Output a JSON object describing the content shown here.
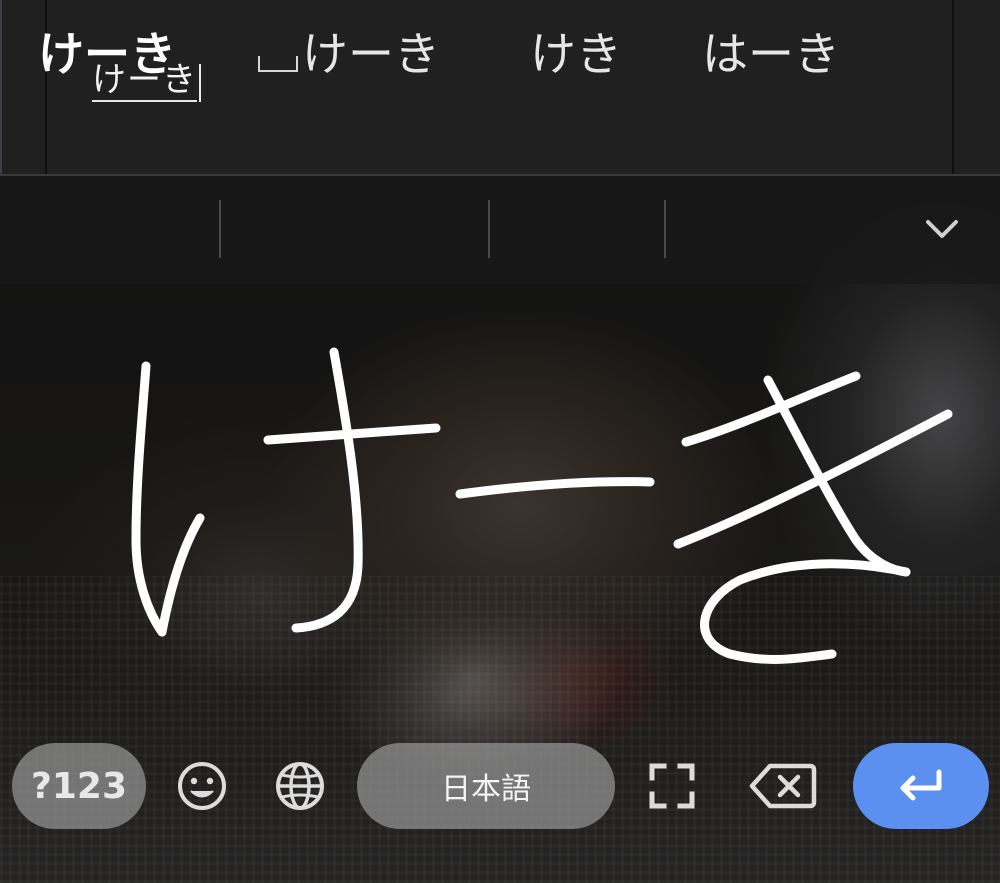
{
  "text_field": {
    "composing_text": "けーき"
  },
  "suggestions": {
    "items": [
      {
        "label": "けーき"
      },
      {
        "label": "けーき"
      },
      {
        "label": "けき"
      },
      {
        "label": "はーき"
      }
    ],
    "expand_icon": "chevron-down-icon"
  },
  "handwriting": {
    "recognized": "けーき",
    "ink_color": "#ffffff"
  },
  "bottom_row": {
    "symbols_label": "?123",
    "emoji_icon": "smiley-icon",
    "language_icon": "globe-icon",
    "space_label": "日本語",
    "fullscreen_icon": "fullscreen-icon",
    "delete_icon": "backspace-icon",
    "enter_icon": "enter-arrow-icon"
  },
  "colors": {
    "enter_key": "#5b8ff0",
    "pill_key": "#969696",
    "panel": "#202020"
  }
}
